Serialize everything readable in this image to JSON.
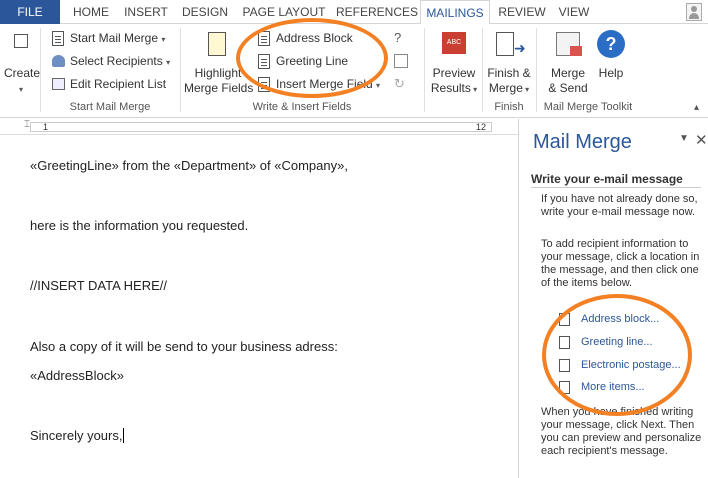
{
  "tabs": [
    {
      "label": "FILE"
    },
    {
      "label": "HOME"
    },
    {
      "label": "INSERT"
    },
    {
      "label": "DESIGN"
    },
    {
      "label": "PAGE LAYOUT"
    },
    {
      "label": "REFERENCES"
    },
    {
      "label": "MAILINGS"
    },
    {
      "label": "REVIEW"
    },
    {
      "label": "VIEW"
    }
  ],
  "ribbon": {
    "create": "Create",
    "start_mail_merge": "Start Mail Merge",
    "select_recipients": "Select Recipients",
    "edit_recipient_list": "Edit Recipient List",
    "group_start": "Start Mail Merge",
    "highlight_line1": "Highlight",
    "highlight_line2": "Merge Fields",
    "address_block": "Address Block",
    "greeting_line": "Greeting Line",
    "insert_merge_field": "Insert Merge Field",
    "group_write": "Write & Insert Fields",
    "preview_line1": "Preview",
    "preview_line2": "Results",
    "preview_abc": "ABC",
    "finish_line1": "Finish &",
    "finish_line2": "Merge",
    "group_finish": "Finish",
    "merge_send_line1": "Merge",
    "merge_send_line2": "& Send",
    "help": "Help",
    "group_toolkit": "Mail Merge Toolkit"
  },
  "ruler": {
    "left_num": "1",
    "right_num": "12"
  },
  "document": {
    "line1": "«GreetingLine» from the «Department» of «Company»,",
    "line2": "here is the information you requested.",
    "line3": "//INSERT DATA HERE//",
    "line4": "Also a copy of it will be send to your business adress:",
    "line5": "«AddressBlock»",
    "line6": "Sincerely yours,"
  },
  "pane": {
    "title": "Mail Merge",
    "heading": "Write your e-mail message",
    "para1": "If you have not already done so, write your e-mail message now.",
    "para2": "To add recipient information to your message, click a location in the message, and then click one of the items below.",
    "links": [
      "Address block...",
      "Greeting line...",
      "Electronic postage...",
      "More items..."
    ],
    "para3": "When you have finished writing your message, click Next. Then you can preview and personalize each recipient's message."
  },
  "colors": {
    "accent": "#2b579a",
    "annotation": "#f48024"
  }
}
